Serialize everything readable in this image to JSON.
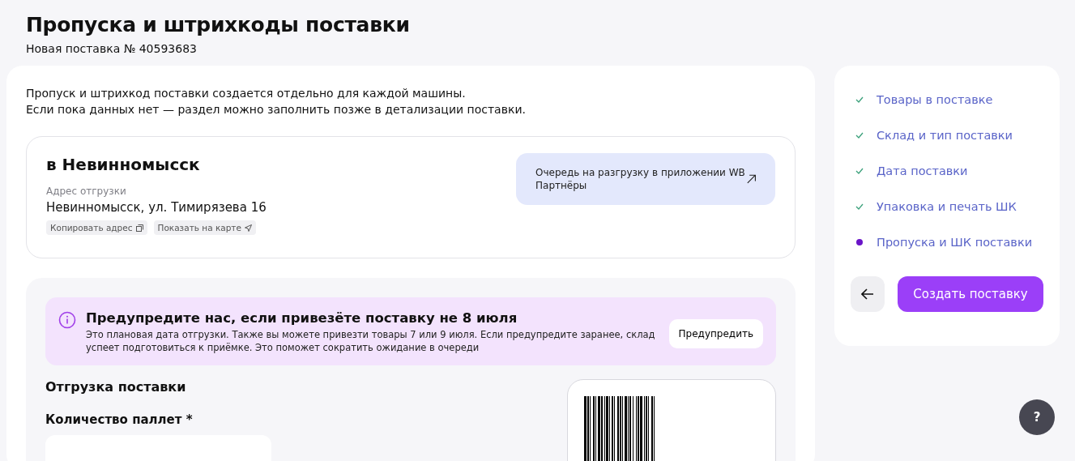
{
  "header": {
    "title": "Пропуска и штрихкоды поставки",
    "subtitle": "Новая поставка № 40593683"
  },
  "intro": [
    "Пропуск и штрихкод поставки создается отдельно для каждой машины.",
    "Если пока данных нет — раздел можно заполнить позже в детализации поставки."
  ],
  "warehouse": {
    "title": "в Невинномысск",
    "address_label": "Адрес отгрузки",
    "address": "Невинномысск, ул. Тимирязева 16",
    "actions": [
      {
        "label": "Копировать адрес",
        "kind": "copy"
      },
      {
        "label": "Показать на карте",
        "kind": "map"
      }
    ],
    "queue_link": "Очередь на разгрузку в приложении WB Партнёры"
  },
  "notice": {
    "title": "Предупредите нас, если привезёте поставку не 8 июля",
    "text": "Это плановая дата отгрузки. Также вы можете привезти товары 7 или 9 июля. Если предупредите заранее, склад успеет подготовиться к приёмке. Это поможет сократить ожидание в очереди",
    "button": "Предупредить"
  },
  "shipment": {
    "title": "Отгрузка поставки",
    "pallets_label": "Количество паллет *"
  },
  "steps": [
    {
      "label": "Товары в поставке",
      "done": true
    },
    {
      "label": "Склад и тип поставки",
      "done": true
    },
    {
      "label": "Дата поставки",
      "done": true
    },
    {
      "label": "Упаковка и печать ШК",
      "done": true
    },
    {
      "label": "Пропуска и ШК поставки",
      "done": false
    }
  ],
  "create_button": "Создать поставку",
  "help_button": "?"
}
